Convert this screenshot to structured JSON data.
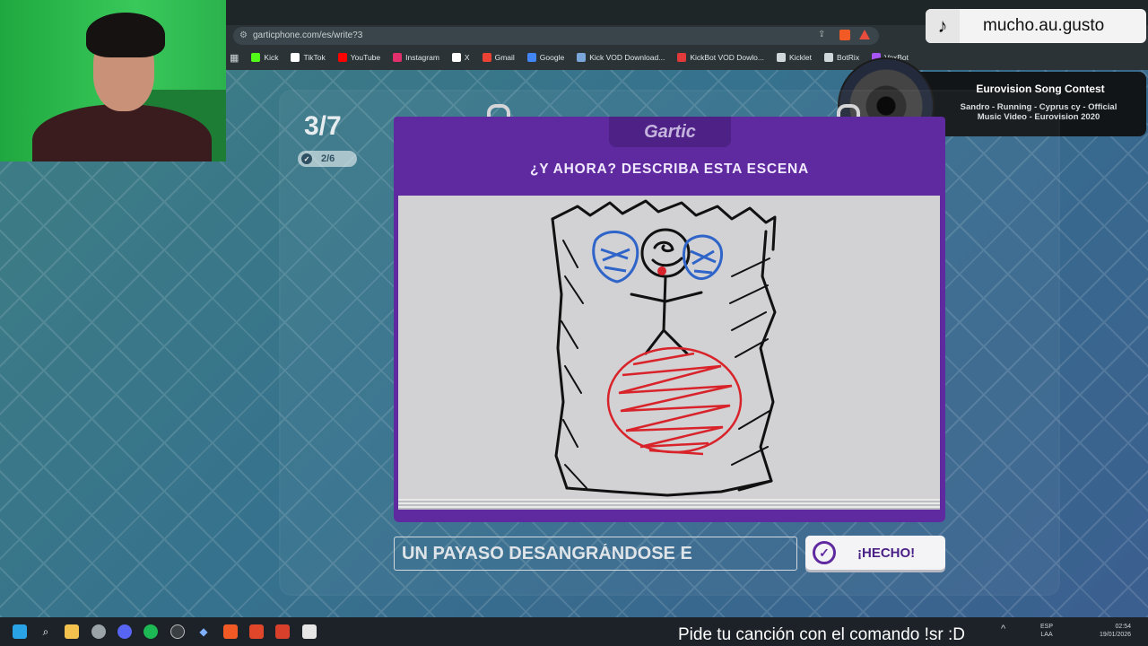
{
  "browser": {
    "url": "garticphone.com/es/write?3",
    "bookmarks": [
      {
        "label": "Kick",
        "color": "#53fc18"
      },
      {
        "label": "TikTok",
        "color": "#ffffff"
      },
      {
        "label": "YouTube",
        "color": "#ff0000"
      },
      {
        "label": "Instagram",
        "color": "#e1306c"
      },
      {
        "label": "X",
        "color": "#ffffff"
      },
      {
        "label": "Gmail",
        "color": "#ea4335"
      },
      {
        "label": "Google",
        "color": "#4285f4"
      },
      {
        "label": "Kick VOD Download...",
        "color": "#7aa6d9"
      },
      {
        "label": "KickBot VOD Dowlo...",
        "color": "#e03a3a"
      },
      {
        "label": "Kicklet",
        "color": "#cfd7da"
      },
      {
        "label": "BotRix",
        "color": "#cfd7da"
      },
      {
        "label": "VoxBot",
        "color": "#a855f7"
      }
    ]
  },
  "overlay": {
    "tiktok_user": "mucho.au.gusto",
    "now_playing": {
      "title": "Eurovision Song Contest",
      "subtitle": "Sandro - Running - Cyprus cy - Official Music Video - Eurovision 2020"
    },
    "song_request": "Pide tu canción con el comando !sr :D"
  },
  "game": {
    "round": "3/7",
    "players_done": "2/6",
    "logo": "Gartic",
    "heading": "¿Y AHORA? DESCRIBA ESTA ESCENA",
    "answer_value": "UN PAYASO DESANGRÁNDOSE E",
    "done_label": "¡HECHO!"
  },
  "taskbar": {
    "lang_top": "ESP",
    "lang_bottom": "LAA",
    "time": "02:54",
    "date": "19/01/2026"
  },
  "colors": {
    "purple": "#5f2aa0",
    "canvas": "#d2d2d4",
    "blue_ink": "#2f64c8",
    "red_ink": "#d8232a"
  }
}
